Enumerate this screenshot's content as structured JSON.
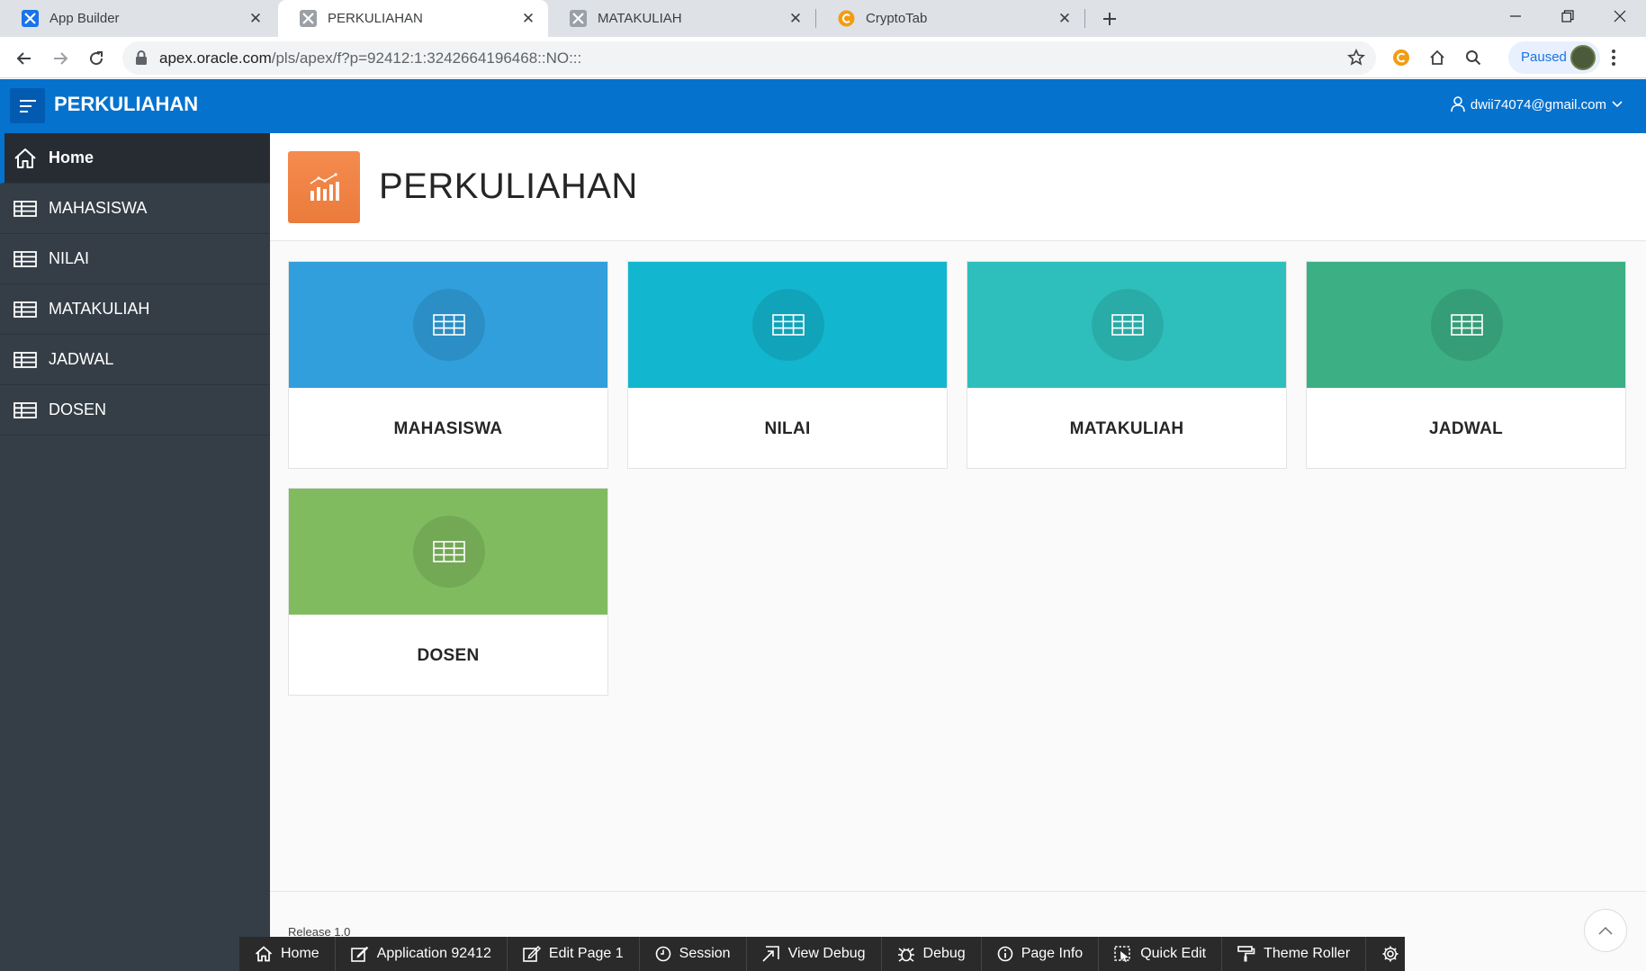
{
  "browser": {
    "tabs": [
      {
        "label": "App Builder",
        "icon": "apex-icon",
        "active": false
      },
      {
        "label": "PERKULIAHAN",
        "icon": "apex-grey-icon",
        "active": true
      },
      {
        "label": "MATAKULIAH",
        "icon": "apex-grey-icon",
        "active": false
      },
      {
        "label": "CryptoTab",
        "icon": "cryptotab-icon",
        "active": false
      }
    ],
    "url_host": "apex.oracle.com",
    "url_path": "/pls/apex/f?p=92412:1:3242664196468::NO:::",
    "profile_status": "Paused"
  },
  "app": {
    "title": "PERKULIAHAN",
    "user_email": "dwii74074@gmail.com",
    "accent": "#0572ce"
  },
  "sidebar": {
    "items": [
      {
        "label": "Home",
        "icon": "home-icon"
      },
      {
        "label": "MAHASISWA",
        "icon": "table-icon"
      },
      {
        "label": "NILAI",
        "icon": "table-icon"
      },
      {
        "label": "MATAKULIAH",
        "icon": "table-icon"
      },
      {
        "label": "JADWAL",
        "icon": "table-icon"
      },
      {
        "label": "DOSEN",
        "icon": "table-icon"
      }
    ]
  },
  "page": {
    "title": "PERKULIAHAN",
    "hero_icon": "chart-icon",
    "hero_color": "#f0844a",
    "cards": [
      {
        "title": "MAHASISWA",
        "color": "#309fdb",
        "icon": "table-icon"
      },
      {
        "title": "NILAI",
        "color": "#13b6cf",
        "icon": "table-icon"
      },
      {
        "title": "MATAKULIAH",
        "color": "#2ebfbc",
        "icon": "table-icon"
      },
      {
        "title": "JADWAL",
        "color": "#3caf85",
        "icon": "table-icon"
      },
      {
        "title": "DOSEN",
        "color": "#81bb5f",
        "icon": "table-icon"
      }
    ],
    "footer_release": "Release 1.0"
  },
  "dev_toolbar": {
    "items": [
      {
        "label": "Home",
        "icon": "home-icon"
      },
      {
        "label": "Application 92412",
        "icon": "edit-icon"
      },
      {
        "label": "Edit Page 1",
        "icon": "pencil-icon"
      },
      {
        "label": "Session",
        "icon": "clock-icon"
      },
      {
        "label": "View Debug",
        "icon": "view-debug-icon"
      },
      {
        "label": "Debug",
        "icon": "bug-icon"
      },
      {
        "label": "Page Info",
        "icon": "info-icon"
      },
      {
        "label": "Quick Edit",
        "icon": "quick-edit-icon"
      },
      {
        "label": "Theme Roller",
        "icon": "paint-roller-icon"
      },
      {
        "label": "",
        "icon": "gear-icon"
      }
    ]
  }
}
